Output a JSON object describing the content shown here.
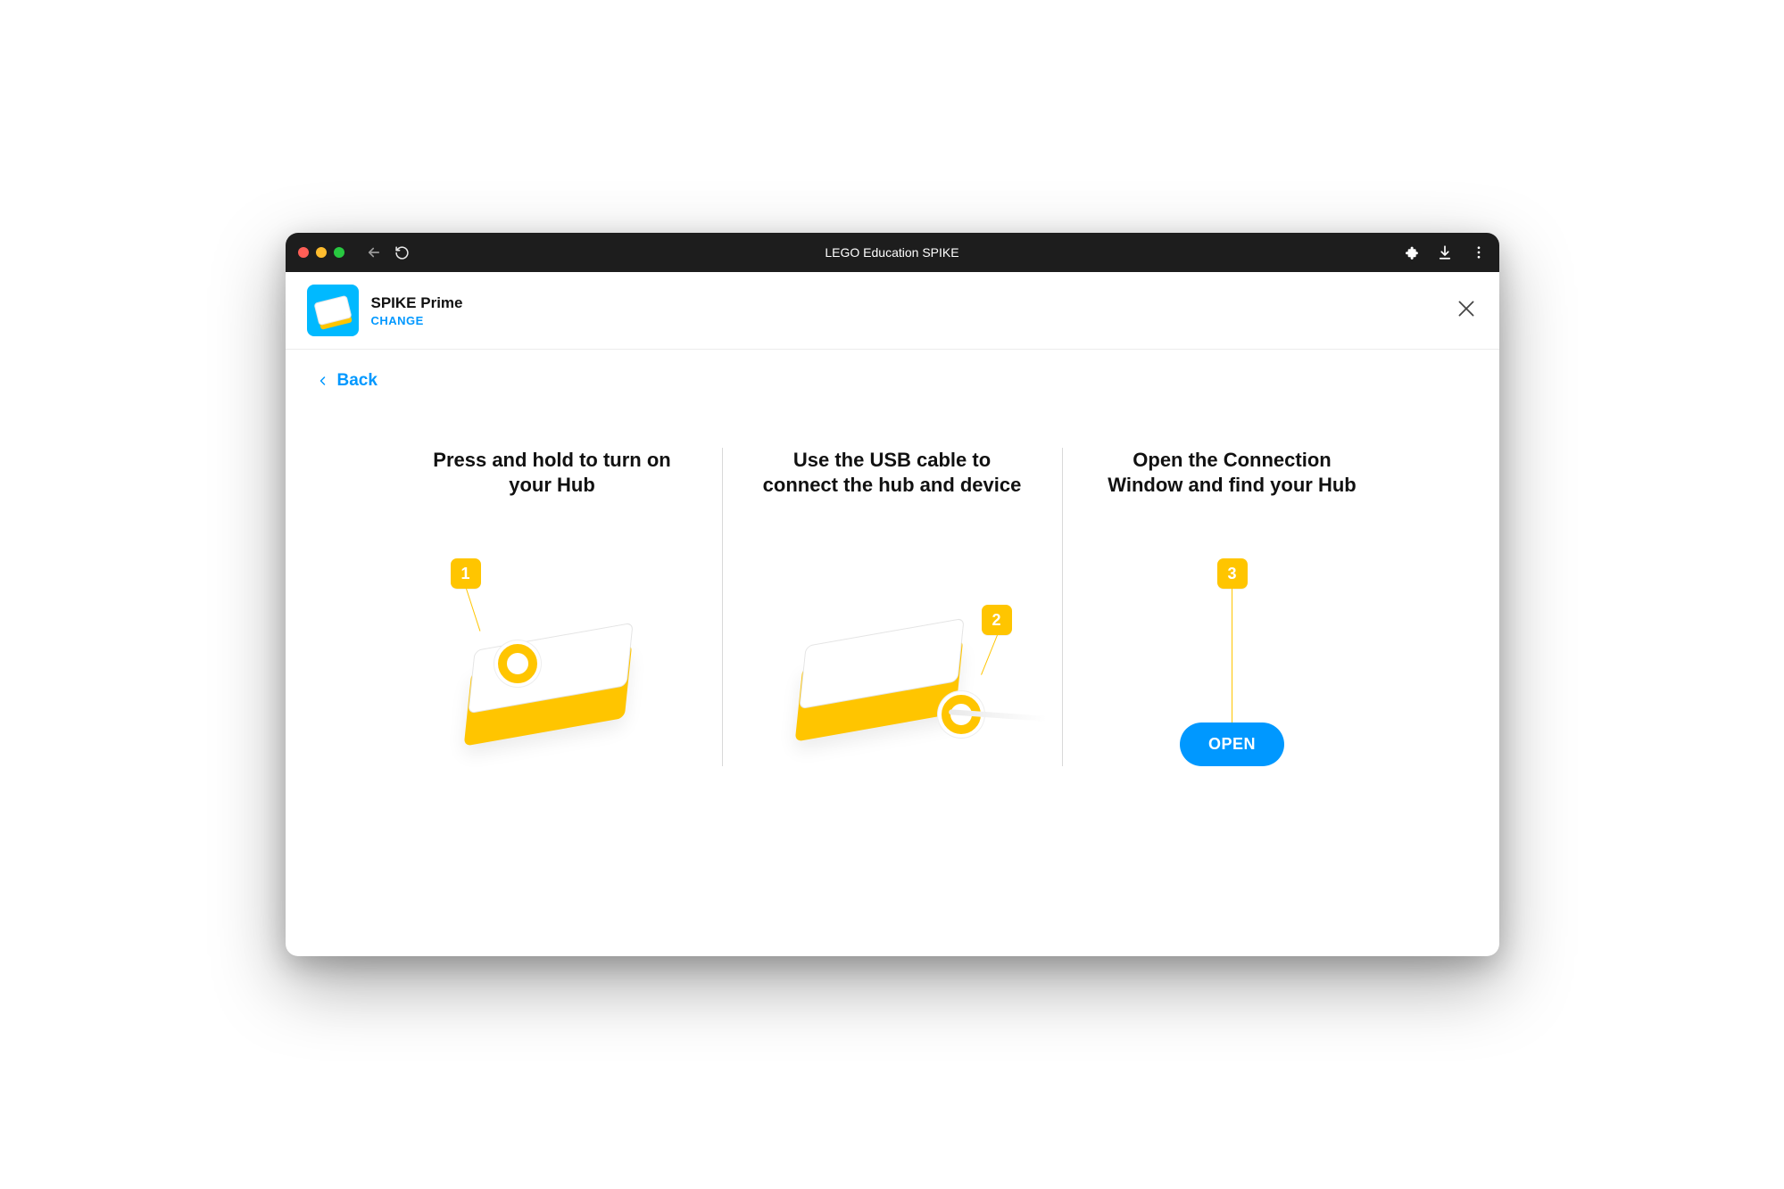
{
  "titlebar": {
    "title": "LEGO Education SPIKE"
  },
  "header": {
    "product_name": "SPIKE Prime",
    "change_label": "CHANGE"
  },
  "nav": {
    "back_label": "Back"
  },
  "steps": {
    "s1": {
      "title": "Press and hold to turn on your Hub",
      "badge": "1"
    },
    "s2": {
      "title": "Use the USB cable to connect the hub and device",
      "badge": "2"
    },
    "s3": {
      "title": "Open the Connection Window and find your Hub",
      "badge": "3",
      "button": "OPEN"
    }
  }
}
